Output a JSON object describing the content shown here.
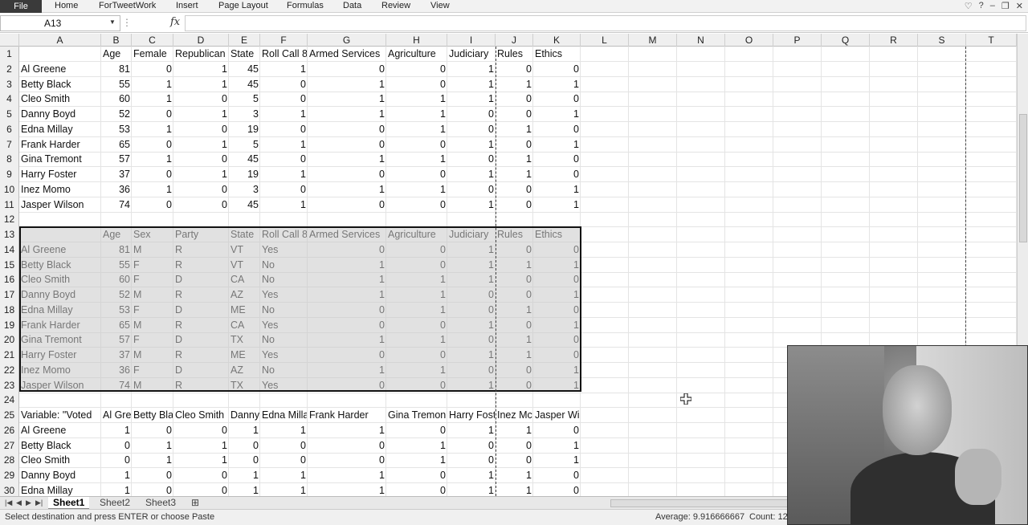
{
  "ribbon": {
    "file": "File",
    "tabs": [
      "Home",
      "ForTweetWork",
      "Insert",
      "Page Layout",
      "Formulas",
      "Data",
      "Review",
      "View"
    ],
    "window_controls": [
      "♡",
      "?",
      "–",
      "❐",
      "✕"
    ]
  },
  "formula_bar": {
    "name_box": "A13",
    "fx": "fx",
    "formula": ""
  },
  "columns": [
    "A",
    "B",
    "C",
    "D",
    "E",
    "F",
    "G",
    "H",
    "I",
    "J",
    "K",
    "L",
    "M",
    "N",
    "O",
    "P",
    "Q",
    "R",
    "S",
    "T"
  ],
  "rows": [
    {
      "n": "1",
      "cells": [
        "",
        "Age",
        "Female",
        "Republican",
        "State",
        "Roll Call 8",
        "Armed Services",
        "Agriculture",
        "Judiciary",
        "Rules",
        "Ethics"
      ]
    },
    {
      "n": "2",
      "cells": [
        "Al Greene",
        "81",
        "0",
        "1",
        "45",
        "1",
        "0",
        "0",
        "1",
        "0",
        "0"
      ]
    },
    {
      "n": "3",
      "cells": [
        "Betty Black",
        "55",
        "1",
        "1",
        "45",
        "0",
        "1",
        "0",
        "1",
        "1",
        "1"
      ]
    },
    {
      "n": "4",
      "cells": [
        "Cleo Smith",
        "60",
        "1",
        "0",
        "5",
        "0",
        "1",
        "1",
        "1",
        "0",
        "0"
      ]
    },
    {
      "n": "5",
      "cells": [
        "Danny Boyd",
        "52",
        "0",
        "1",
        "3",
        "1",
        "1",
        "1",
        "0",
        "0",
        "1"
      ]
    },
    {
      "n": "6",
      "cells": [
        "Edna Millay",
        "53",
        "1",
        "0",
        "19",
        "0",
        "0",
        "1",
        "0",
        "1",
        "0"
      ]
    },
    {
      "n": "7",
      "cells": [
        "Frank Harder",
        "65",
        "0",
        "1",
        "5",
        "1",
        "0",
        "0",
        "1",
        "0",
        "1"
      ]
    },
    {
      "n": "8",
      "cells": [
        "Gina Tremont",
        "57",
        "1",
        "0",
        "45",
        "0",
        "1",
        "1",
        "0",
        "1",
        "0"
      ]
    },
    {
      "n": "9",
      "cells": [
        "Harry Foster",
        "37",
        "0",
        "1",
        "19",
        "1",
        "0",
        "0",
        "1",
        "1",
        "0"
      ]
    },
    {
      "n": "10",
      "cells": [
        "Inez Momo",
        "36",
        "1",
        "0",
        "3",
        "0",
        "1",
        "1",
        "0",
        "0",
        "1"
      ]
    },
    {
      "n": "11",
      "cells": [
        "Jasper Wilson",
        "74",
        "0",
        "0",
        "45",
        "1",
        "0",
        "0",
        "1",
        "0",
        "1"
      ]
    },
    {
      "n": "12",
      "cells": [
        "",
        "",
        "",
        "",
        "",
        "",
        "",
        "",
        "",
        "",
        ""
      ]
    },
    {
      "n": "13",
      "cells": [
        "",
        "Age",
        "Sex",
        "Party",
        "State",
        "Roll Call 8",
        "Armed Services",
        "Agriculture",
        "Judiciary",
        "Rules",
        "Ethics"
      ]
    },
    {
      "n": "14",
      "cells": [
        "Al Greene",
        "81",
        "M",
        "R",
        "VT",
        "Yes",
        "0",
        "0",
        "1",
        "0",
        "0"
      ]
    },
    {
      "n": "15",
      "cells": [
        "Betty Black",
        "55",
        "F",
        "R",
        "VT",
        "No",
        "1",
        "0",
        "1",
        "1",
        "1"
      ]
    },
    {
      "n": "16",
      "cells": [
        "Cleo Smith",
        "60",
        "F",
        "D",
        "CA",
        "No",
        "1",
        "1",
        "1",
        "0",
        "0"
      ]
    },
    {
      "n": "17",
      "cells": [
        "Danny Boyd",
        "52",
        "M",
        "R",
        "AZ",
        "Yes",
        "1",
        "1",
        "0",
        "0",
        "1"
      ]
    },
    {
      "n": "18",
      "cells": [
        "Edna Millay",
        "53",
        "F",
        "D",
        "ME",
        "No",
        "0",
        "1",
        "0",
        "1",
        "0"
      ]
    },
    {
      "n": "19",
      "cells": [
        "Frank Harder",
        "65",
        "M",
        "R",
        "CA",
        "Yes",
        "0",
        "0",
        "1",
        "0",
        "1"
      ]
    },
    {
      "n": "20",
      "cells": [
        "Gina Tremont",
        "57",
        "F",
        "D",
        "TX",
        "No",
        "1",
        "1",
        "0",
        "1",
        "0"
      ]
    },
    {
      "n": "21",
      "cells": [
        "Harry Foster",
        "37",
        "M",
        "R",
        "ME",
        "Yes",
        "0",
        "0",
        "1",
        "1",
        "0"
      ]
    },
    {
      "n": "22",
      "cells": [
        "Inez Momo",
        "36",
        "F",
        "D",
        "AZ",
        "No",
        "1",
        "1",
        "0",
        "0",
        "1"
      ]
    },
    {
      "n": "23",
      "cells": [
        "Jasper Wilson",
        "74",
        "M",
        "R",
        "TX",
        "Yes",
        "0",
        "0",
        "1",
        "0",
        "1"
      ]
    },
    {
      "n": "24",
      "cells": [
        "",
        "",
        "",
        "",
        "",
        "",
        "",
        "",
        "",
        "",
        ""
      ]
    },
    {
      "n": "25",
      "cells": [
        "Variable: \"Voted",
        "Al Gre",
        "Betty Bla",
        "Cleo Smith",
        "Danny",
        "Edna Milla",
        "Frank Harder",
        "Gina Tremon",
        "Harry Fost",
        "Inez Mc",
        "Jasper Wilson"
      ]
    },
    {
      "n": "26",
      "cells": [
        "Al Greene",
        "1",
        "0",
        "0",
        "1",
        "1",
        "1",
        "0",
        "1",
        "1",
        "0"
      ]
    },
    {
      "n": "27",
      "cells": [
        "Betty Black",
        "0",
        "1",
        "1",
        "0",
        "0",
        "0",
        "1",
        "0",
        "0",
        "1"
      ]
    },
    {
      "n": "28",
      "cells": [
        "Cleo Smith",
        "0",
        "1",
        "1",
        "0",
        "0",
        "0",
        "1",
        "0",
        "0",
        "1"
      ]
    },
    {
      "n": "29",
      "cells": [
        "Danny Boyd",
        "1",
        "0",
        "0",
        "1",
        "1",
        "1",
        "0",
        "1",
        "1",
        "0"
      ]
    },
    {
      "n": "30",
      "cells": [
        "Edna Millay",
        "1",
        "0",
        "0",
        "1",
        "1",
        "1",
        "0",
        "1",
        "1",
        "0"
      ]
    }
  ],
  "sheets": [
    "Sheet1",
    "Sheet2",
    "Sheet3"
  ],
  "active_sheet": "Sheet1",
  "status": {
    "message": "Select destination and press ENTER or choose Paste",
    "average": "Average: 9.916666667",
    "count": "Count: 12"
  }
}
